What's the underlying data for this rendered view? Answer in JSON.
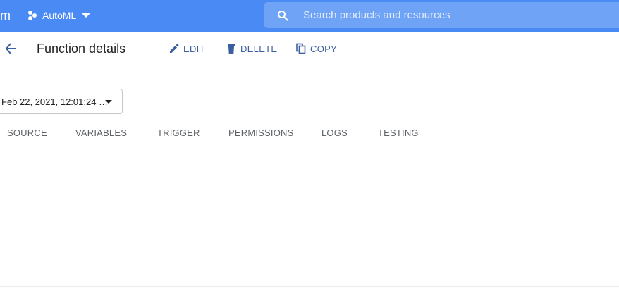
{
  "header": {
    "brand_fragment": "m",
    "project": {
      "name": "AutoML",
      "icon": "project-dots-icon"
    },
    "search": {
      "placeholder": "Search products and resources",
      "value": "",
      "icon": "search-icon"
    },
    "background_color": "#4a8af4"
  },
  "action_bar": {
    "back_icon": "arrow-back-icon",
    "title": "Function details",
    "actions": [
      {
        "label": "EDIT",
        "icon": "pencil-icon"
      },
      {
        "label": "DELETE",
        "icon": "trash-icon"
      },
      {
        "label": "COPY",
        "icon": "copy-icon"
      }
    ],
    "action_color": "#3b5fa0"
  },
  "version_selector": {
    "value": "Feb 22, 2021, 12:01:24 …"
  },
  "tabs": [
    "SOURCE",
    "VARIABLES",
    "TRIGGER",
    "PERMISSIONS",
    "LOGS",
    "TESTING"
  ]
}
